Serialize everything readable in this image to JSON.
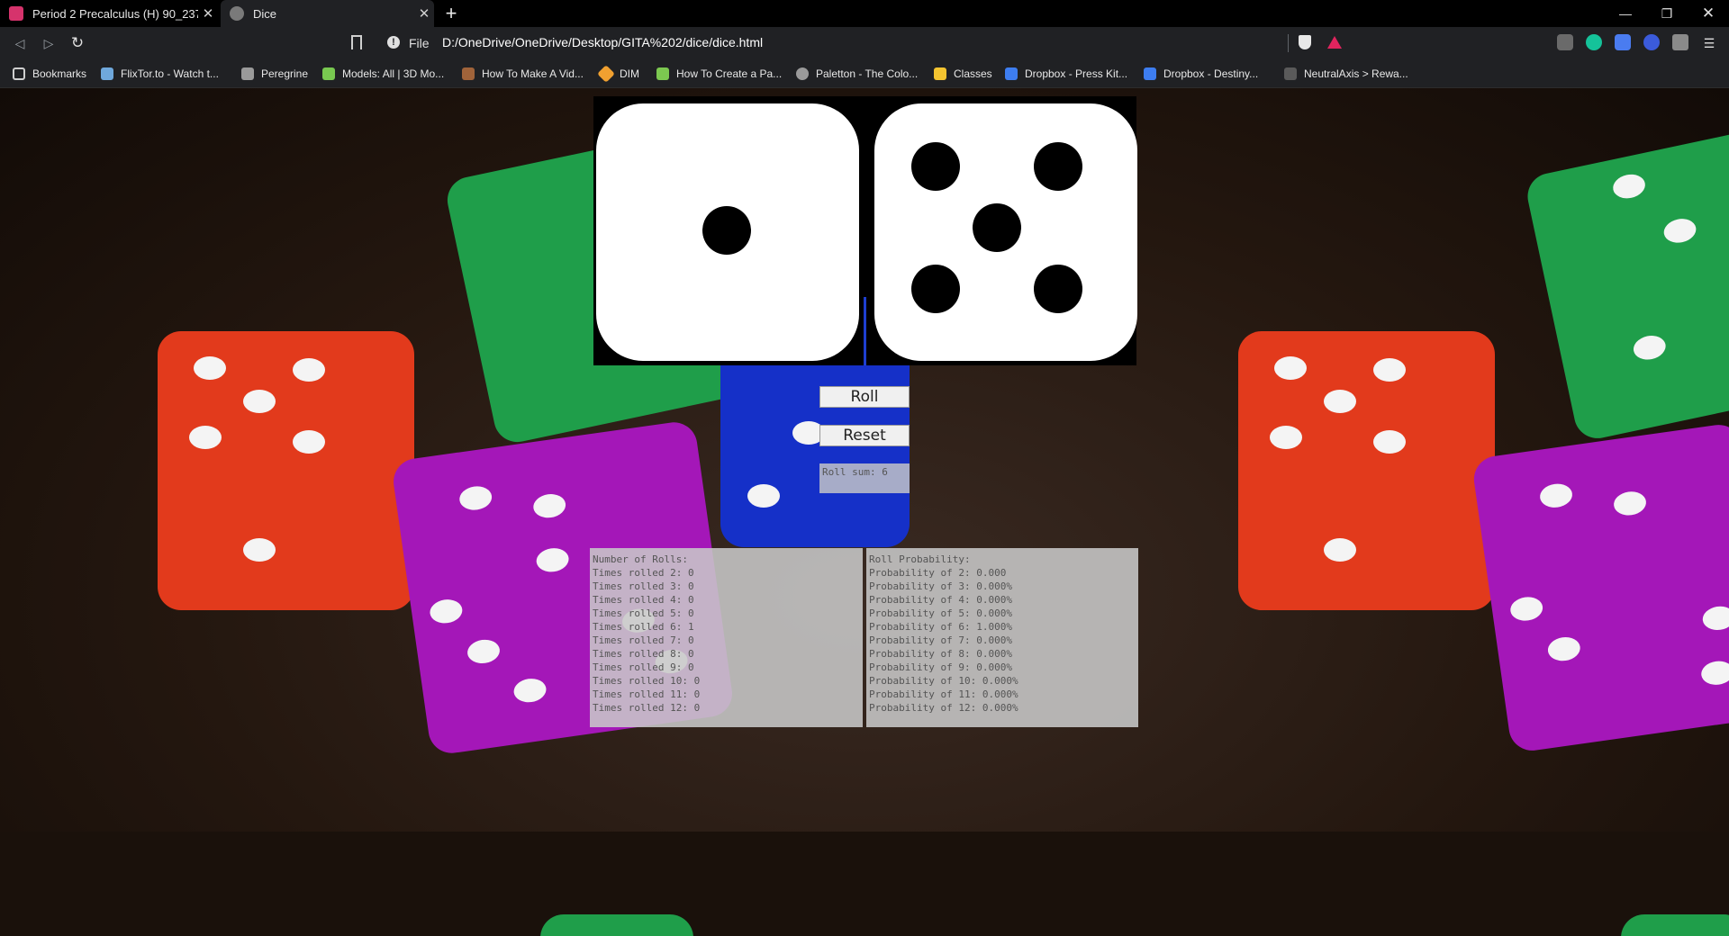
{
  "tabs": [
    {
      "title": "Period 2 Precalculus (H) 90_237",
      "active": false
    },
    {
      "title": "Dice",
      "active": true
    }
  ],
  "toolbar": {
    "scheme_label": "File",
    "url": "D:/OneDrive/OneDrive/Desktop/GITA%202/dice/dice.html"
  },
  "bookmarks": [
    {
      "label": "Bookmarks",
      "icon": "bookmarks-icon",
      "color": "#cfcfcf"
    },
    {
      "label": "FlixTor.to - Watch t...",
      "icon": "flixtor-icon",
      "color": "#6fa8dc"
    },
    {
      "label": "Peregrine",
      "icon": "peregrine-icon",
      "color": "#9a9a9a"
    },
    {
      "label": "Models: All | 3D Mo...",
      "icon": "models-icon",
      "color": "#78c850"
    },
    {
      "label": "How To Make A Vid...",
      "icon": "box-icon",
      "color": "#a0633a"
    },
    {
      "label": "DIM",
      "icon": "dim-icon",
      "color": "#f0a030"
    },
    {
      "label": "How To Create a Pa...",
      "icon": "chart-icon",
      "color": "#7cc850"
    },
    {
      "label": "Paletton - The Colo...",
      "icon": "paletton-icon",
      "color": "#9a9a9a"
    },
    {
      "label": "Classes",
      "icon": "classroom-icon",
      "color": "#f4c430"
    },
    {
      "label": "Dropbox - Press Kit...",
      "icon": "dropbox-icon",
      "color": "#3d7df0"
    },
    {
      "label": "Dropbox - Destiny...",
      "icon": "dropbox-icon",
      "color": "#3d7df0"
    },
    {
      "label": "NeutralAxis > Rewa...",
      "icon": "shield-icon",
      "color": "#5a5a5a"
    }
  ],
  "dice": {
    "die1": 1,
    "die2": 5
  },
  "controls": {
    "roll_label": "Roll",
    "reset_label": "Reset",
    "roll_sum": "Roll sum: 6"
  },
  "stats": {
    "counts_header": "Number of Rolls:",
    "counts": [
      "Times rolled 2: 0",
      "Times rolled 3: 0",
      "Times rolled 4: 0",
      "Times rolled 5: 0",
      "Times rolled 6: 1",
      "Times rolled 7: 0",
      "Times rolled 8: 0",
      "Times rolled 9: 0",
      "Times rolled 10: 0",
      "Times rolled 11: 0",
      "Times rolled 12: 0"
    ],
    "prob_header": "Roll Probability:",
    "probabilities": [
      "Probability of 2: 0.000",
      "Probability of 3: 0.000%",
      "Probability of 4: 0.000%",
      "Probability of 5: 0.000%",
      "Probability of 6: 1.000%",
      "Probability of 7: 0.000%",
      "Probability of 8: 0.000%",
      "Probability of 9: 0.000%",
      "Probability of 10: 0.000%",
      "Probability of 11: 0.000%",
      "Probability of 12: 0.000%"
    ]
  },
  "colors": {
    "die_red": "#e23a1c",
    "die_green": "#1f9e4a",
    "die_purple": "#a417b8",
    "die_blue": "#1530c8"
  }
}
